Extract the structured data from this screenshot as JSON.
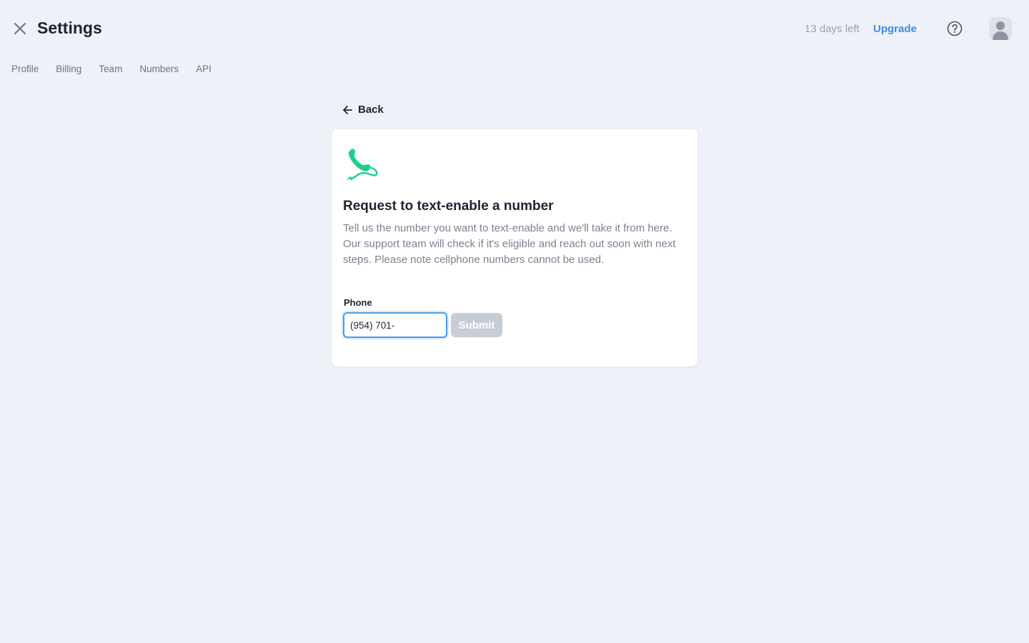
{
  "header": {
    "title": "Settings",
    "trial_text": "13 days left",
    "upgrade_label": "Upgrade",
    "icons": [
      "close-icon",
      "help-icon",
      "avatar"
    ]
  },
  "tabs": [
    {
      "label": "Profile"
    },
    {
      "label": "Billing"
    },
    {
      "label": "Team"
    },
    {
      "label": "Numbers"
    },
    {
      "label": "API"
    }
  ],
  "back_label": "Back",
  "card": {
    "icon": "phone-icon",
    "heading": "Request to text-enable a number",
    "description": "Tell us the number you want to text-enable and we'll take it from here. Our support team will check if it's eligible and reach out soon with next steps. Please note cellphone numbers cannot be used.",
    "phone_label": "Phone",
    "phone_value": "(954) 701-",
    "submit_label": "Submit"
  },
  "colors": {
    "accent": "#3a8ee0",
    "icon_green": "#1ed18a",
    "background": "#eef1f7"
  }
}
